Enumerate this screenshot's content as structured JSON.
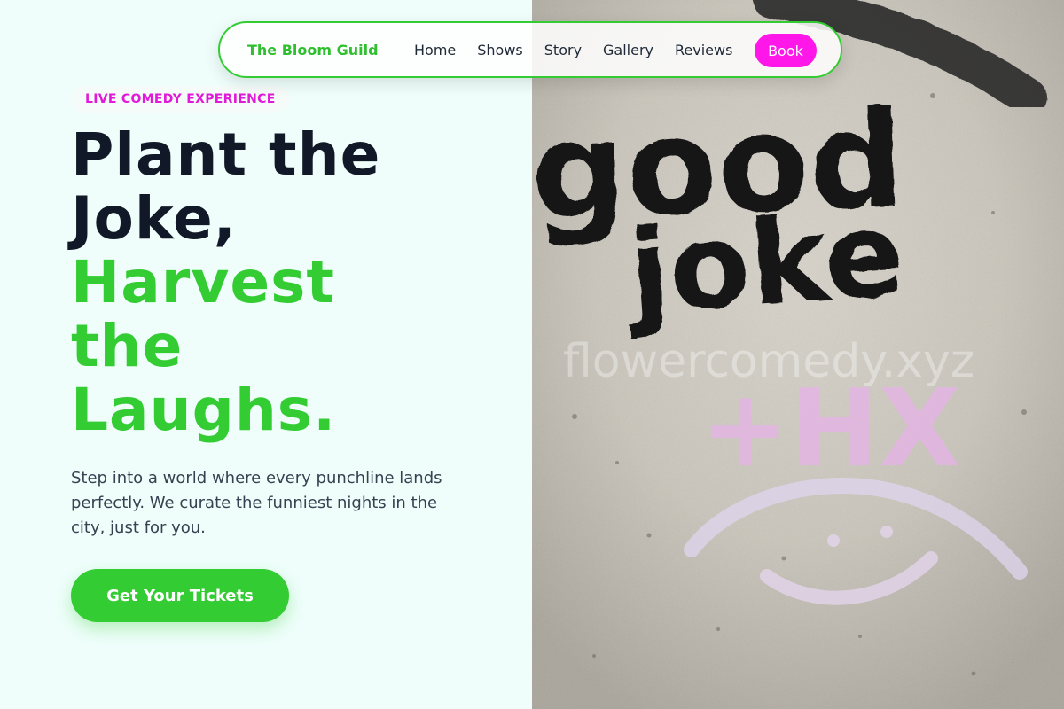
{
  "nav": {
    "brand": "The Bloom Guild",
    "links": [
      "Home",
      "Shows",
      "Story",
      "Gallery",
      "Reviews"
    ],
    "cta": "Book"
  },
  "hero": {
    "eyebrow": "LIVE COMEDY EXPERIENCE",
    "headline_dark": [
      "Plant the",
      "Joke,"
    ],
    "headline_green": [
      "Harvest",
      "the",
      "Laughs."
    ],
    "lede": "Step into a world where every punchline lands perfectly. We curate the funniest nights in the city, just for you.",
    "button": "Get Your Tickets"
  },
  "image": {
    "graffiti_line_1": "good",
    "graffiti_line_2": "joke",
    "graffiti_line_3": "+HX",
    "watermark": "flowercomedy.xyz"
  },
  "colors": {
    "accent_green": "#33cc33",
    "accent_magenta": "#ff16e9",
    "background": "#effefb",
    "dark_text": "#111827"
  }
}
